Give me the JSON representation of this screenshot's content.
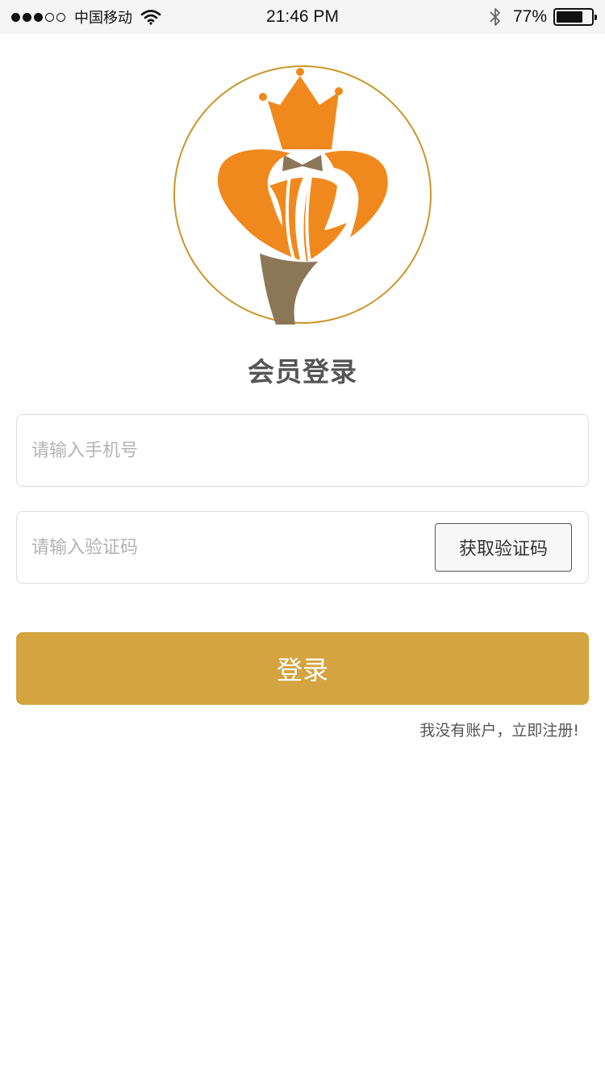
{
  "status_bar": {
    "carrier": "中国移动",
    "time": "21:46 PM",
    "battery_percent": "77%",
    "battery_level": 0.77,
    "signal_bars": 3,
    "icons": [
      "wifi-icon",
      "bluetooth-icon",
      "battery-icon"
    ]
  },
  "logo": {
    "icon": "crown-torch-logo",
    "colors": {
      "orange": "#f0891d",
      "brown": "#8c7658",
      "ring": "#c9962a"
    }
  },
  "title": "会员登录",
  "phone_field": {
    "placeholder": "请输入手机号",
    "value": ""
  },
  "code_field": {
    "placeholder": "请输入验证码",
    "value": ""
  },
  "get_code_button": "获取验证码",
  "login_button": "登录",
  "register_link": "我没有账户，立即注册!",
  "colors": {
    "accent": "#d4a441",
    "border": "#dcdcdc",
    "title": "#555555"
  }
}
